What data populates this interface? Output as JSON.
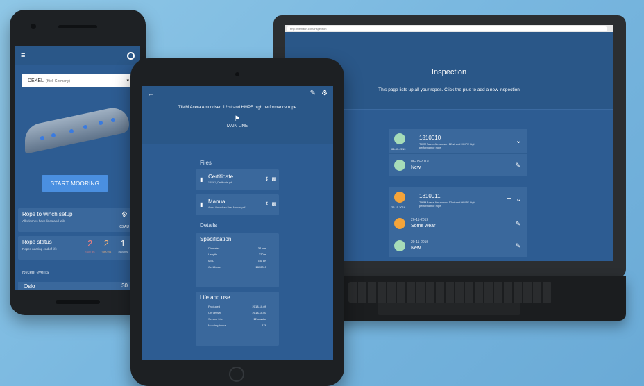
{
  "phone": {
    "vessel_name": "DEKEL",
    "vessel_location": "(Kiel, Germany)",
    "start_button": "START MOORING",
    "rope_winch_title": "Rope to winch setup",
    "rope_winch_subtitle": "All winches have lines and tails",
    "rope_winch_date": "03 AU",
    "rope_status_title": "Rope status",
    "rope_status_subtitle": "Ropes nearing end of life",
    "rope_status_counts": [
      {
        "value": "2",
        "label": "<400 hrs"
      },
      {
        "value": "2",
        "label": "<600 hrs"
      },
      {
        "value": "1",
        "label": ">600 hrs"
      }
    ],
    "recent_events_label": "Recent events",
    "event_partial_label": "Oslo",
    "event_partial_value": "30"
  },
  "laptop": {
    "url": "tmp.witsmann.com/inspection",
    "page_title": "Inspection",
    "page_subtitle": "This page lists up all your ropes. Click the plus to add a new inspection",
    "ropes": [
      {
        "id": "1810010",
        "date": "06-03-2019",
        "description": "TIMM Acera Amundsen 12 strand HMPE high performance rope",
        "avatar_color": "#a6dcb8",
        "inspections": [
          {
            "date": "06-03-2019",
            "label": "New",
            "color": "#a6dcb8"
          }
        ]
      },
      {
        "id": "1810011",
        "date": "26-11-2019",
        "description": "TIMM Acera Amundsen 12 strand HMPE high performance rope",
        "avatar_color": "#f4a43a",
        "inspections": [
          {
            "date": "26-11-2019",
            "label": "Some wear",
            "color": "#f4a43a"
          },
          {
            "date": "20-11-2019",
            "label": "New",
            "color": "#a6dcb8"
          }
        ]
      }
    ]
  },
  "tablet": {
    "title": "TIMM Acera Amundsen 12 strand HMPE high performance rope",
    "subtitle": "MAIN LINE",
    "files_label": "Files",
    "files": [
      {
        "name": "Certificate",
        "file": "1ASH1_Certificate.pdf"
      },
      {
        "name": "Manual",
        "file": "Acera Amundsen User Manual.pdf"
      }
    ],
    "details_label": "Details",
    "specification": {
      "title": "Specification",
      "rows": [
        {
          "key": "Diameter",
          "value": "32 mm"
        },
        {
          "key": "Length",
          "value": "220 m"
        },
        {
          "key": "MBL",
          "value": "780 kN"
        },
        {
          "key": "Certificate",
          "value": "1810013"
        }
      ]
    },
    "life": {
      "title": "Life and use",
      "rows": [
        {
          "key": "Produced",
          "value": "2018-10-09"
        },
        {
          "key": "On Vessel",
          "value": "2018-10-03"
        },
        {
          "key": "Service Life",
          "value": "12 months"
        },
        {
          "key": "Mooring hours",
          "value": "178"
        }
      ]
    }
  }
}
